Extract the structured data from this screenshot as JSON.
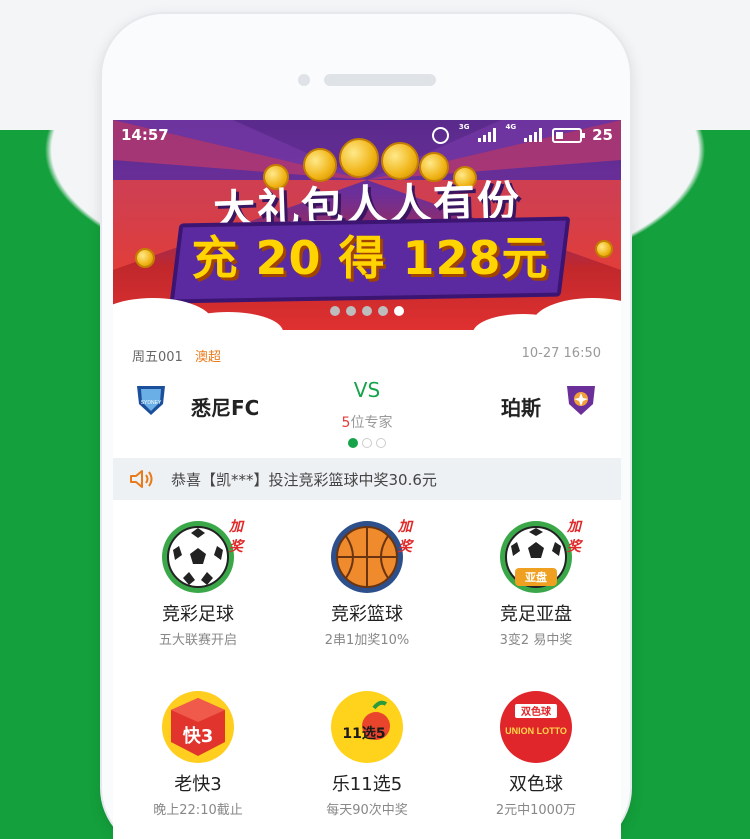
{
  "status_bar": {
    "time": "14:57",
    "network_1": "3G",
    "network_2": "4G",
    "battery": "25"
  },
  "banner": {
    "title": "大礼包人人有份",
    "subtitle": "充 20 得 128元",
    "page_count": 5,
    "active_page": 5
  },
  "match": {
    "id": "周五001",
    "league": "澳超",
    "datetime": "10-27 16:50",
    "home_team": "悉尼FC",
    "home_logo_text": "SYDNEY",
    "away_team": "珀斯",
    "vs_label": "VS",
    "expert_count": "5",
    "expert_suffix": "位专家",
    "page_count": 3,
    "active_page": 1
  },
  "notice": {
    "icon": "speaker-icon",
    "text": "恭喜【凯***】投注竞彩篮球中奖30.6元"
  },
  "games": [
    {
      "name": "竞彩足球",
      "desc": "五大联赛开启",
      "badge": "加奖",
      "icon": "football-icon"
    },
    {
      "name": "竞彩篮球",
      "desc": "2串1加奖10%",
      "badge": "加奖",
      "icon": "basketball-icon"
    },
    {
      "name": "竞足亚盘",
      "desc": "3变2 易中奖",
      "badge": "加奖",
      "icon": "asian-handicap-icon",
      "icon_label": "亚盘"
    },
    {
      "name": "老快3",
      "desc": "晚上22:10截止",
      "icon": "kuai3-icon",
      "icon_label": "快3"
    },
    {
      "name": "乐11选5",
      "desc": "每天90次中奖",
      "icon": "11x5-icon",
      "icon_label": "11选5"
    },
    {
      "name": "双色球",
      "desc": "2元中1000万",
      "icon": "union-lotto-icon",
      "icon_label": "双色球",
      "icon_label_2": "UNION LOTTO"
    }
  ],
  "colors": {
    "brand_green": "#14a03c",
    "accent_orange": "#e87a1a",
    "badge_red": "#e02a2a"
  }
}
